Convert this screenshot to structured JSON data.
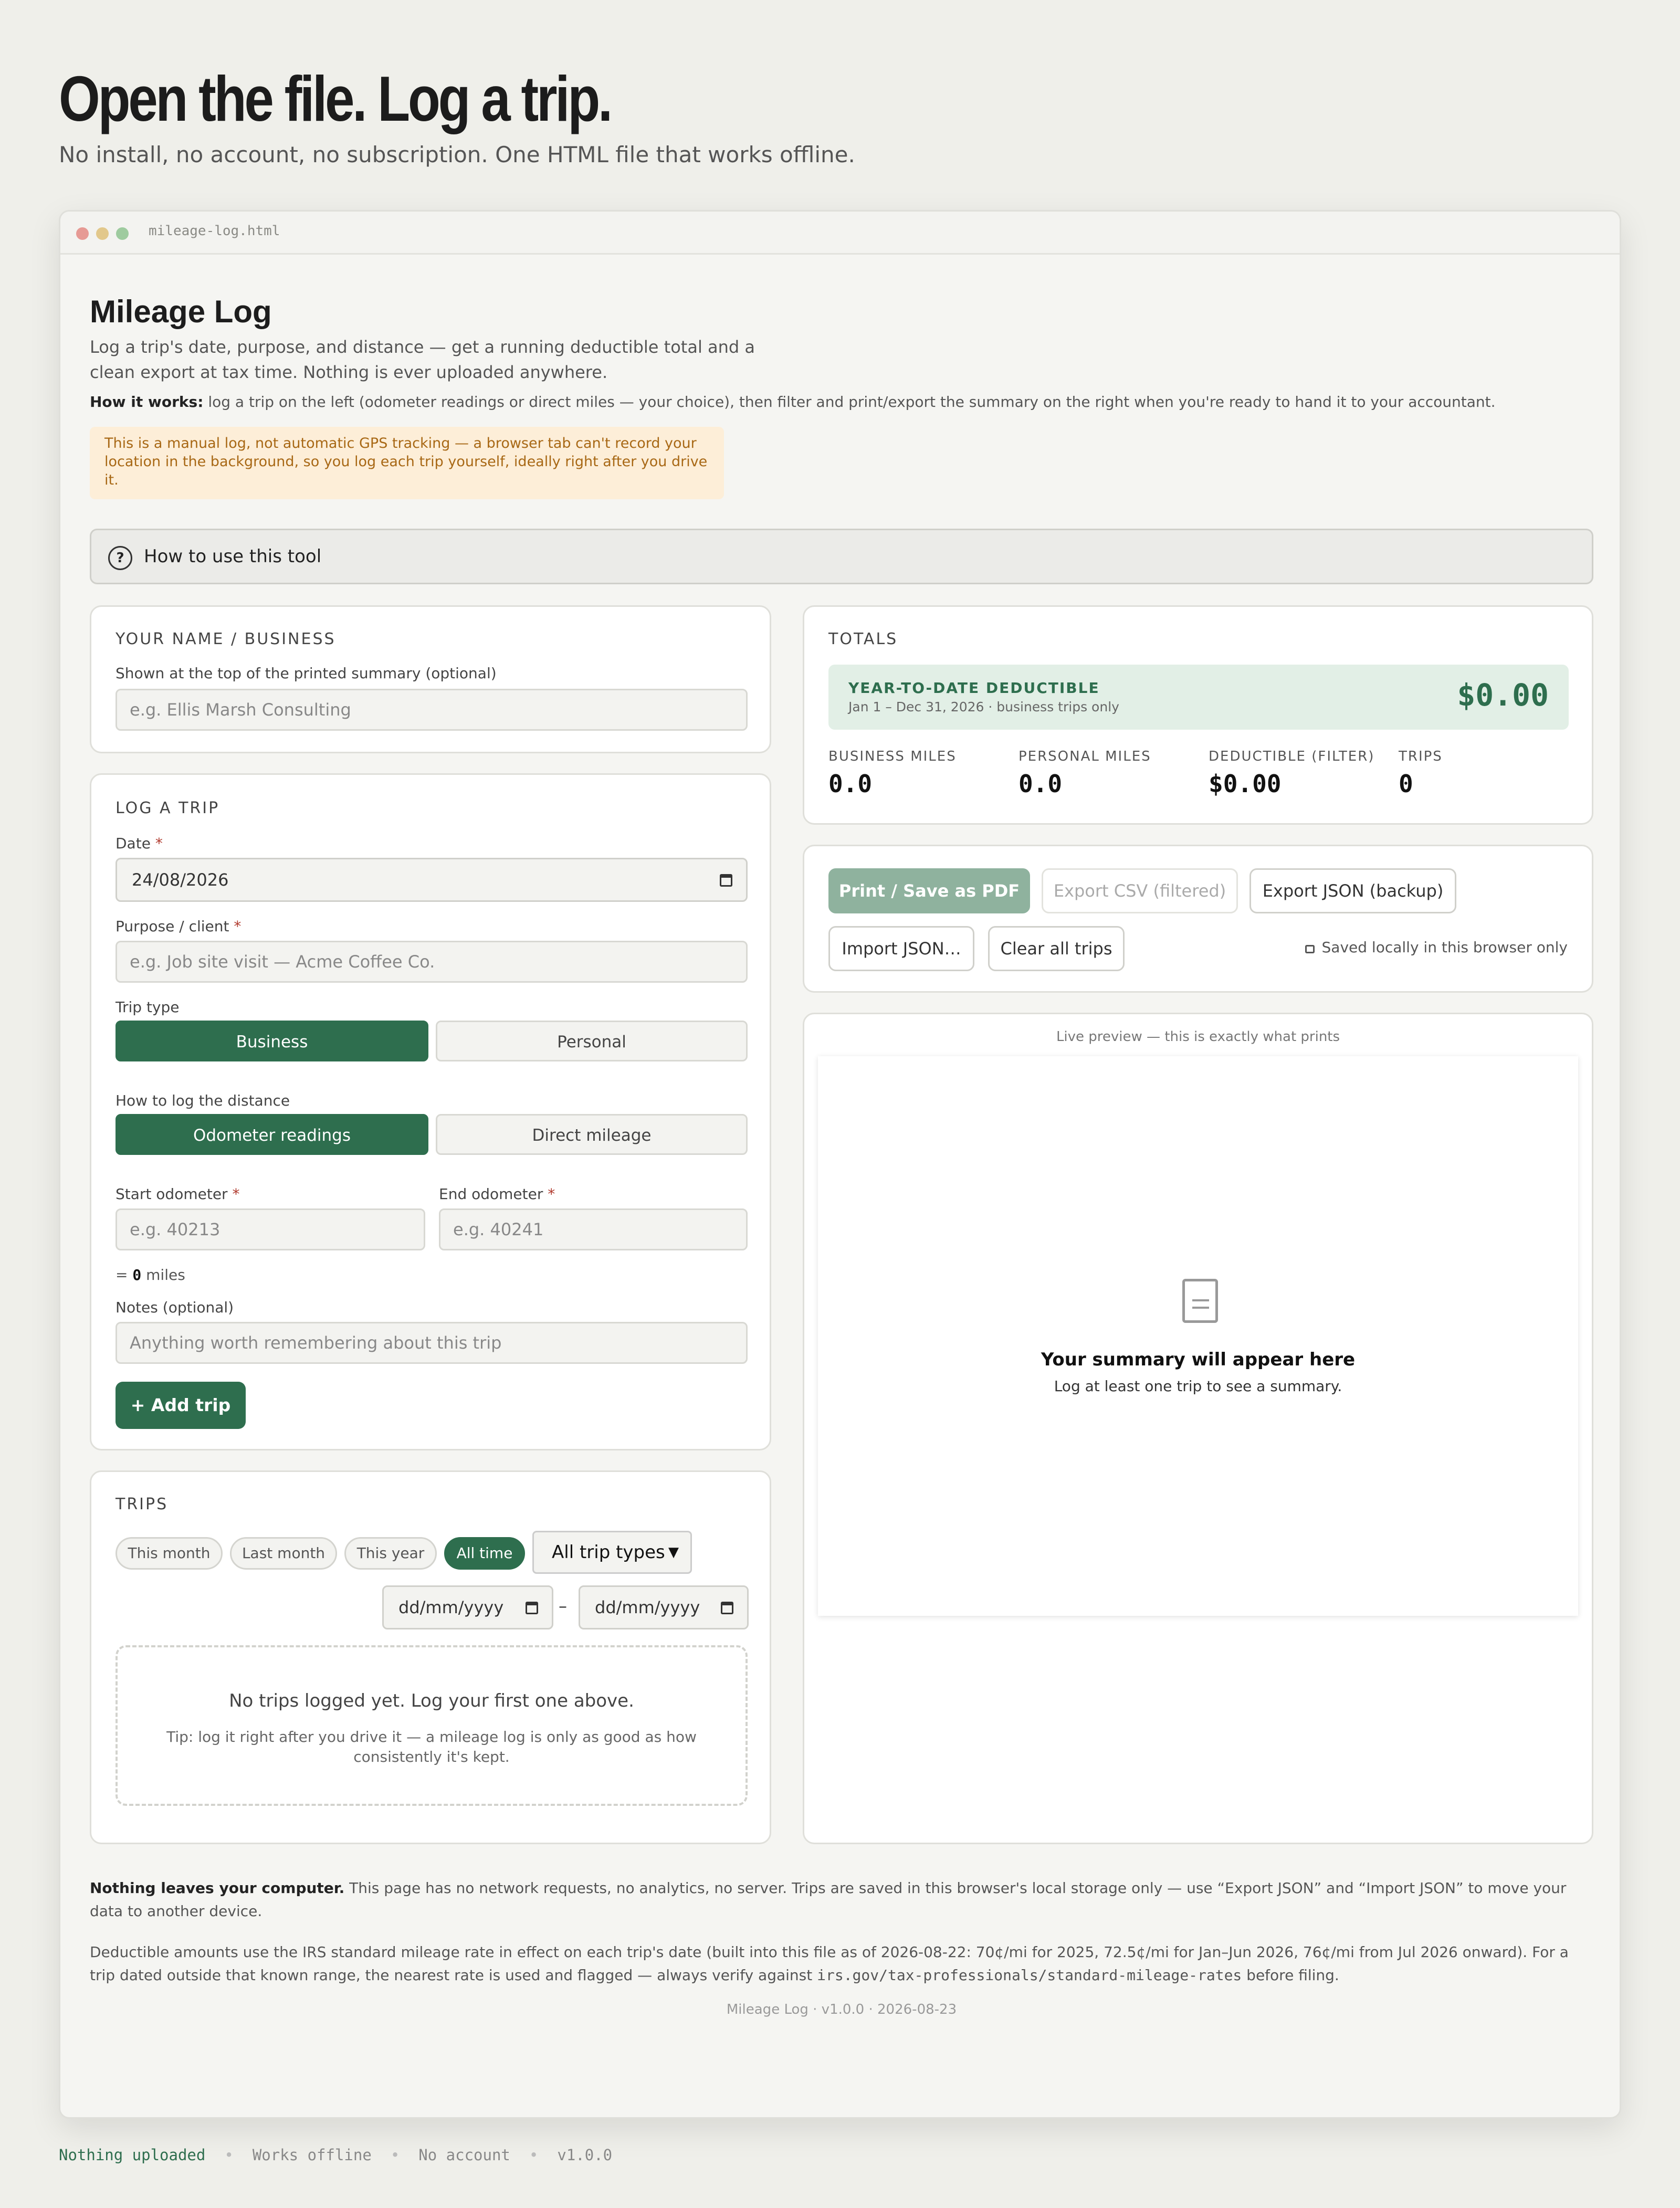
{
  "hero": {
    "title": "Open the file. Log a trip.",
    "subtitle": "No install, no account, no subscription. One HTML file that works offline."
  },
  "window": {
    "filename": "mileage-log.html"
  },
  "app": {
    "title": "Mileage Log",
    "description": "Log a trip's date, purpose, and distance — get a running deductible total and a clean export at tax time. Nothing is ever uploaded anywhere.",
    "how_it_works_label": "How it works:",
    "how_it_works_text": " log a trip on the left (odometer readings or direct miles — your choice), then filter and print/export the summary on the right when you're ready to hand it to your accountant.",
    "notice": "This is a manual log, not automatic GPS tracking — a browser tab can't record your location in the background, so you log each trip yourself, ideally right after you drive it.",
    "how_to_use": "How to use this tool"
  },
  "name_card": {
    "heading": "YOUR NAME / BUSINESS",
    "label": "Shown at the top of the printed summary (optional)",
    "placeholder": "e.g. Ellis Marsh Consulting"
  },
  "log_trip": {
    "heading": "LOG A TRIP",
    "date_label": "Date",
    "date_value": "24/08/2026",
    "purpose_label": "Purpose / client",
    "purpose_placeholder": "e.g. Job site visit — Acme Coffee Co.",
    "trip_type_label": "Trip type",
    "trip_types": [
      "Business",
      "Personal"
    ],
    "distance_label": "How to log the distance",
    "distance_modes": [
      "Odometer readings",
      "Direct mileage"
    ],
    "start_label": "Start odometer",
    "start_placeholder": "e.g. 40213",
    "end_label": "End odometer",
    "end_placeholder": "e.g. 40241",
    "miles_prefix": "= ",
    "miles_value": "0",
    "miles_suffix": " miles",
    "notes_label": "Notes (optional)",
    "notes_placeholder": "Anything worth remembering about this trip",
    "add_button": "+ Add trip",
    "required_mark": "*"
  },
  "trips": {
    "heading": "TRIPS",
    "filters": [
      "This month",
      "Last month",
      "This year",
      "All time"
    ],
    "active_filter": "All time",
    "type_select": "All trip types",
    "date_from": "dd/mm/yyyy",
    "date_to": "dd/mm/yyyy",
    "range_sep": "–",
    "empty_title": "No trips logged yet. Log your first one above.",
    "empty_tip": "Tip: log it right after you drive it — a mileage log is only as good as how consistently it's kept."
  },
  "totals": {
    "heading": "TOTALS",
    "ytd_label": "YEAR-TO-DATE DEDUCTIBLE",
    "ytd_range": "Jan 1 – Dec 31, 2026 · business trips only",
    "ytd_value": "$0.00",
    "stats": [
      {
        "label": "BUSINESS MILES",
        "value": "0.0"
      },
      {
        "label": "PERSONAL MILES",
        "value": "0.0"
      },
      {
        "label": "DEDUCTIBLE (FILTER)",
        "value": "$0.00"
      },
      {
        "label": "TRIPS",
        "value": "0"
      }
    ]
  },
  "actions": {
    "print": "Print / Save as PDF",
    "export_csv": "Export CSV (filtered)",
    "export_json": "Export JSON (backup)",
    "import_json": "Import JSON…",
    "clear": "Clear all trips",
    "saved": "Saved locally in this browser only"
  },
  "preview": {
    "caption": "Live preview — this is exactly what prints",
    "title": "Your summary will appear here",
    "subtitle": "Log at least one trip to see a summary."
  },
  "footer": {
    "privacy_bold": "Nothing leaves your computer.",
    "privacy_text": " This page has no network requests, no analytics, no server. Trips are saved in this browser's local storage only — use “Export JSON” and “Import JSON” to move your data to another device.",
    "rate_text": "Deductible amounts use the IRS standard mileage rate in effect on each trip's date (built into this file as of 2026-08-22: 70¢/mi for 2025, 72.5¢/mi for Jan–Jun 2026, 76¢/mi from Jul 2026 onward). For a trip dated outside that known range, the nearest rate is used and flagged — always verify against ",
    "rate_url": "irs.gov/tax-professionals/standard-mileage-rates",
    "rate_end": " before filing.",
    "version": "Mileage Log · v1.0.0 · 2026-08-23"
  },
  "statusbar": [
    "Nothing uploaded",
    "Works offline",
    "No account",
    "v1.0.0"
  ],
  "colors": {
    "accent": "#2e6e4e",
    "background": "#efefea",
    "notice": "#fdeed8"
  }
}
